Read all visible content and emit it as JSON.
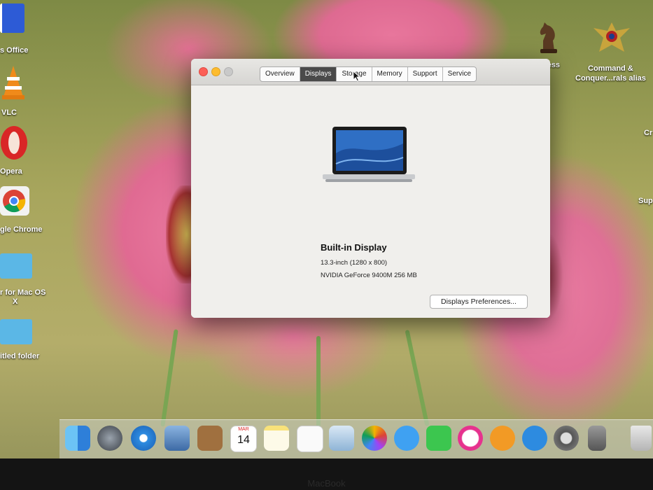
{
  "desktop": {
    "left_icons": [
      {
        "label": "s Office",
        "icon": "office-doc-icon"
      },
      {
        "label": "VLC",
        "icon": "vlc-cone-icon"
      },
      {
        "label": "Opera",
        "icon": "opera-icon"
      },
      {
        "label": "gle Chrome",
        "icon": "chrome-icon"
      },
      {
        "label": "r for Mac OS",
        "label2": "X",
        "icon": "folder-icon"
      },
      {
        "label": "itled folder",
        "icon": "folder-icon"
      }
    ],
    "right_icons": [
      {
        "label": "Chess",
        "icon": "chess-knight-icon"
      },
      {
        "label": "Command &",
        "label2": "Conquer...rals alias",
        "icon": "command-conquer-icon"
      },
      {
        "label": "Cr"
      },
      {
        "label": "Sup"
      }
    ]
  },
  "window": {
    "tabs": [
      "Overview",
      "Displays",
      "Storage",
      "Memory",
      "Support",
      "Service"
    ],
    "active_tab": "Displays",
    "display_name": "Built-in Display",
    "size_resolution": "13.3-inch (1280 x 800)",
    "graphics": "NVIDIA GeForce 9400M 256 MB",
    "prefs_button": "Displays Preferences..."
  },
  "dock": {
    "apps": [
      "finder-icon",
      "launchpad-icon",
      "safari-icon",
      "photo-app-icon",
      "contacts-icon",
      "calendar-icon",
      "notes-icon",
      "reminders-icon",
      "preview-icon",
      "photos-icon",
      "messages-icon",
      "facetime-icon",
      "itunes-icon",
      "ibooks-icon",
      "app-store-icon",
      "system-preferences-icon",
      "disk-utility-icon",
      "trash-icon"
    ],
    "calendar_month": "MAR",
    "calendar_day": "14"
  },
  "bezel_brand": "MacBook",
  "colors": {
    "active_tab": "#4a4a4a",
    "close": "#fc5f57",
    "minimize": "#fdbc2e",
    "zoom": "#c9c9c9"
  }
}
